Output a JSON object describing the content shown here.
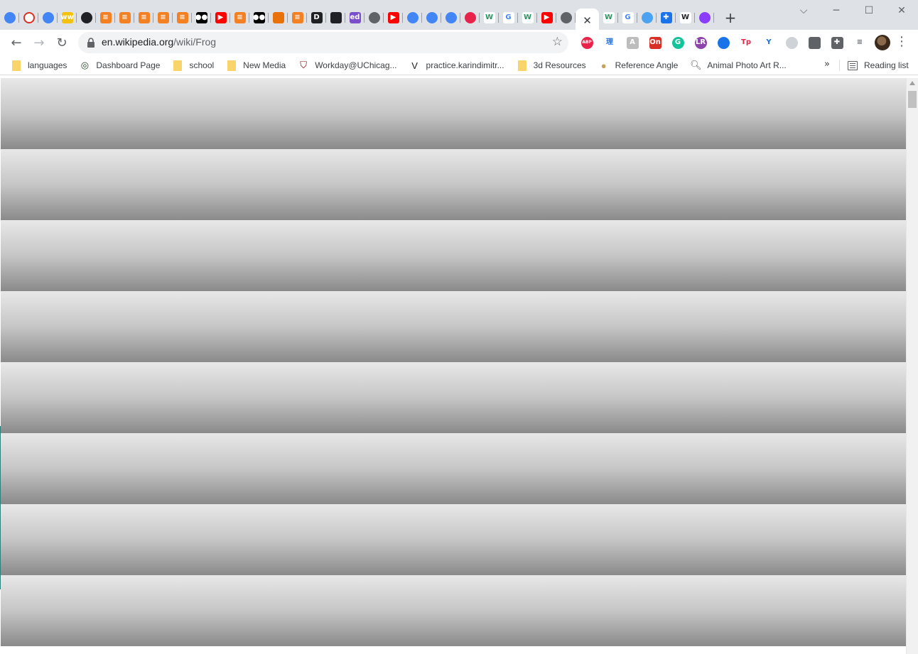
{
  "browser": {
    "active_tab": {
      "close_glyph": "✕"
    },
    "tabs": [
      {
        "icon": "chrome-icon",
        "glyph": "",
        "bg": "#4285f4",
        "shape": "circle"
      },
      {
        "icon": "opera-ring-icon",
        "glyph": "",
        "bg": "#ffffff",
        "shape": "circle"
      },
      {
        "icon": "chrome-icon",
        "glyph": "",
        "bg": "#4285f4",
        "shape": "circle"
      },
      {
        "icon": "ww-icon",
        "glyph": "ww",
        "bg": "#f4c20d",
        "shape": "square"
      },
      {
        "icon": "github-icon",
        "glyph": "",
        "bg": "#202124",
        "shape": "circle"
      },
      {
        "icon": "stackoverflow-icon",
        "glyph": "≡",
        "bg": "#f48024",
        "shape": "square"
      },
      {
        "icon": "stackoverflow-icon",
        "glyph": "≡",
        "bg": "#f48024",
        "shape": "square"
      },
      {
        "icon": "stackoverflow-icon",
        "glyph": "≡",
        "bg": "#f48024",
        "shape": "square"
      },
      {
        "icon": "stackoverflow-icon",
        "glyph": "≡",
        "bg": "#f48024",
        "shape": "square"
      },
      {
        "icon": "stackoverflow-icon",
        "glyph": "≡",
        "bg": "#f48024",
        "shape": "square"
      },
      {
        "icon": "medium-icon",
        "glyph": "●●",
        "bg": "#000000",
        "shape": "square"
      },
      {
        "icon": "youtube-icon",
        "glyph": "▶",
        "bg": "#ff0000",
        "shape": "square"
      },
      {
        "icon": "stackoverflow-icon",
        "glyph": "≡",
        "bg": "#f48024",
        "shape": "square"
      },
      {
        "icon": "medium-icon",
        "glyph": "●●",
        "bg": "#000000",
        "shape": "square"
      },
      {
        "icon": "orange-app-icon",
        "glyph": "",
        "bg": "#e8710a",
        "shape": "square"
      },
      {
        "icon": "stackoverflow-icon",
        "glyph": "≡",
        "bg": "#f48024",
        "shape": "square"
      },
      {
        "icon": "d-icon",
        "glyph": "D",
        "bg": "#202124",
        "shape": "square"
      },
      {
        "icon": "chat-icon",
        "glyph": "",
        "bg": "#202124",
        "shape": "square"
      },
      {
        "icon": "ed-icon",
        "glyph": "ed",
        "bg": "#7b4fc9",
        "shape": "square"
      },
      {
        "icon": "globe-icon",
        "glyph": "",
        "bg": "#5f6368",
        "shape": "circle"
      },
      {
        "icon": "youtube-icon",
        "glyph": "▶",
        "bg": "#ff0000",
        "shape": "square"
      },
      {
        "icon": "chrome-icon",
        "glyph": "",
        "bg": "#4285f4",
        "shape": "circle"
      },
      {
        "icon": "chrome-icon",
        "glyph": "",
        "bg": "#4285f4",
        "shape": "circle"
      },
      {
        "icon": "chrome-icon",
        "glyph": "",
        "bg": "#4285f4",
        "shape": "circle"
      },
      {
        "icon": "target-icon",
        "glyph": "",
        "bg": "#e8234a",
        "shape": "circle"
      },
      {
        "icon": "webflow-icon",
        "glyph": "W",
        "bg": "#ffffff",
        "shape": "square",
        "color": "#1e9c5a"
      },
      {
        "icon": "google-icon",
        "glyph": "G",
        "bg": "#ffffff",
        "shape": "square",
        "color": "#4285f4"
      },
      {
        "icon": "webflow-icon",
        "glyph": "W",
        "bg": "#ffffff",
        "shape": "square",
        "color": "#1e9c5a"
      },
      {
        "icon": "youtube-icon",
        "glyph": "▶",
        "bg": "#ff0000",
        "shape": "square"
      },
      {
        "icon": "globe-icon",
        "glyph": "",
        "bg": "#5f6368",
        "shape": "circle"
      }
    ],
    "tabs_after": [
      {
        "icon": "webflow-icon",
        "glyph": "W",
        "bg": "#ffffff",
        "shape": "square",
        "color": "#1e9c5a"
      },
      {
        "icon": "google-icon",
        "glyph": "G",
        "bg": "#ffffff",
        "shape": "square",
        "color": "#4285f4"
      },
      {
        "icon": "ring-icon",
        "glyph": "",
        "bg": "#4aa3f0",
        "shape": "circle"
      },
      {
        "icon": "puzzle-icon",
        "glyph": "✚",
        "bg": "#1a73e8",
        "shape": "square"
      },
      {
        "icon": "wikipedia-icon",
        "glyph": "W",
        "bg": "#ffffff",
        "shape": "square",
        "color": "#202124"
      },
      {
        "icon": "messenger-icon",
        "glyph": "",
        "bg": "#8b3dff",
        "shape": "circle"
      }
    ],
    "new_tab_glyph": "+",
    "window_controls": {
      "tab_search": "⌵",
      "minimize": "─",
      "maximize": "☐",
      "close": "✕"
    }
  },
  "toolbar": {
    "back_glyph": "←",
    "forward_glyph": "→",
    "reload_glyph": "↻",
    "url_host": "en.wikipedia.org",
    "url_path": "/wiki/Frog",
    "star_glyph": "☆",
    "extensions": [
      {
        "icon": "adblock-icon",
        "glyph": "ABP",
        "bg": "#e8234a",
        "shape": "circle"
      },
      {
        "icon": "chinese-char-icon",
        "glyph": "理",
        "bg": "#ffffff",
        "shape": "square",
        "color": "#1a73e8"
      },
      {
        "icon": "gray-ext-icon",
        "glyph": "A",
        "bg": "#bdbdbd",
        "shape": "square"
      },
      {
        "icon": "on-badge-icon",
        "glyph": "On",
        "bg": "#d93025",
        "shape": "square"
      },
      {
        "icon": "grammarly-icon",
        "glyph": "G",
        "bg": "#15c39a",
        "shape": "circle"
      },
      {
        "icon": "purple-ext-icon",
        "glyph": "LR",
        "bg": "#8e44ad",
        "shape": "circle"
      },
      {
        "icon": "blue-ring-icon",
        "glyph": "",
        "bg": "#1a73e8",
        "shape": "circle"
      },
      {
        "icon": "tp-icon",
        "glyph": "Tp",
        "bg": "#ffffff",
        "shape": "square",
        "color": "#e8234a"
      },
      {
        "icon": "y-icon",
        "glyph": "Y",
        "bg": "#ffffff",
        "shape": "square",
        "color": "#1a73e8"
      },
      {
        "icon": "screenshot-ext-icon",
        "glyph": "",
        "bg": "#cfd3d7",
        "shape": "circle"
      },
      {
        "icon": "chat-bubble-icon",
        "glyph": "",
        "bg": "#5f6368",
        "shape": "square"
      },
      {
        "icon": "puzzle-icon",
        "glyph": "✚",
        "bg": "#5f6368",
        "shape": "square"
      },
      {
        "icon": "media-queue-icon",
        "glyph": "≡",
        "bg": "#ffffff",
        "shape": "square",
        "color": "#5f6368"
      }
    ],
    "menu_glyph": "⋮"
  },
  "bookmarks": [
    {
      "icon": "folder-icon",
      "label": "languages",
      "type": "folder"
    },
    {
      "icon": "dashboard-icon",
      "label": "Dashboard Page",
      "type": "site",
      "glyph": "◎",
      "color": "#1e4620"
    },
    {
      "icon": "folder-icon",
      "label": "school",
      "type": "folder"
    },
    {
      "icon": "folder-icon",
      "label": "New Media",
      "type": "folder"
    },
    {
      "icon": "uchicago-shield-icon",
      "label": "Workday@UChicag...",
      "type": "site",
      "glyph": "⛉",
      "color": "#800000"
    },
    {
      "icon": "v-logo-icon",
      "label": "practice.karindimitr...",
      "type": "site",
      "glyph": "V",
      "color": "#202124"
    },
    {
      "icon": "folder-icon",
      "label": "3d Resources",
      "type": "folder"
    },
    {
      "icon": "reference-angle-icon",
      "label": "Reference Angle",
      "type": "site",
      "glyph": "●",
      "color": "#c9a25a"
    },
    {
      "icon": "search-icon",
      "label": "Animal Photo Art R...",
      "type": "site",
      "glyph": "🔍︎",
      "color": "#5f6368"
    }
  ],
  "bookmarks_more": "»",
  "reading_list_label": "Reading list",
  "content": {
    "band_count": 8,
    "band_top_color": "#e8e8e8",
    "band_bottom_color": "#8a8a8a"
  }
}
